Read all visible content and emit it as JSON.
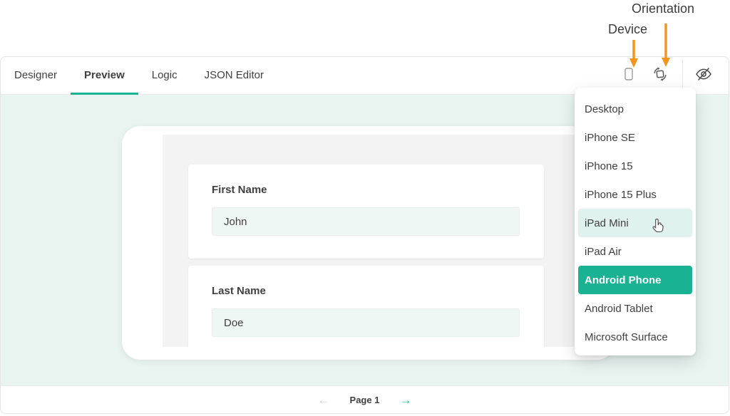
{
  "colors": {
    "accent": "#19b394",
    "accent_soft": "#e0f2ed",
    "annotation_arrow": "#f7941e",
    "mint_bg": "#e9f4f1",
    "screen_bg": "#f3f3f3",
    "input_bg": "#eff7f5",
    "text": "#404040"
  },
  "annotations": {
    "orientation": "Orientation",
    "device": "Device"
  },
  "tabs": [
    {
      "label": "Designer",
      "state": "normal"
    },
    {
      "label": "Preview",
      "state": "active"
    },
    {
      "label": "Logic",
      "state": "normal"
    },
    {
      "label": "JSON Editor",
      "state": "normal"
    }
  ],
  "preview_form": {
    "fields": [
      {
        "label": "First Name",
        "value": "John"
      },
      {
        "label": "Last Name",
        "value": "Doe"
      }
    ]
  },
  "device_menu": {
    "items": [
      {
        "label": "Desktop",
        "state": "normal"
      },
      {
        "label": "iPhone SE",
        "state": "normal"
      },
      {
        "label": "iPhone 15",
        "state": "normal"
      },
      {
        "label": "iPhone 15 Plus",
        "state": "normal"
      },
      {
        "label": "iPad Mini",
        "state": "hovered"
      },
      {
        "label": "iPad Air",
        "state": "normal"
      },
      {
        "label": "Android Phone",
        "state": "selected"
      },
      {
        "label": "Android Tablet",
        "state": "normal"
      },
      {
        "label": "Microsoft Surface",
        "state": "normal"
      }
    ]
  },
  "pagination": {
    "prev_icon": "←",
    "label": "Page 1",
    "next_icon": "→"
  }
}
